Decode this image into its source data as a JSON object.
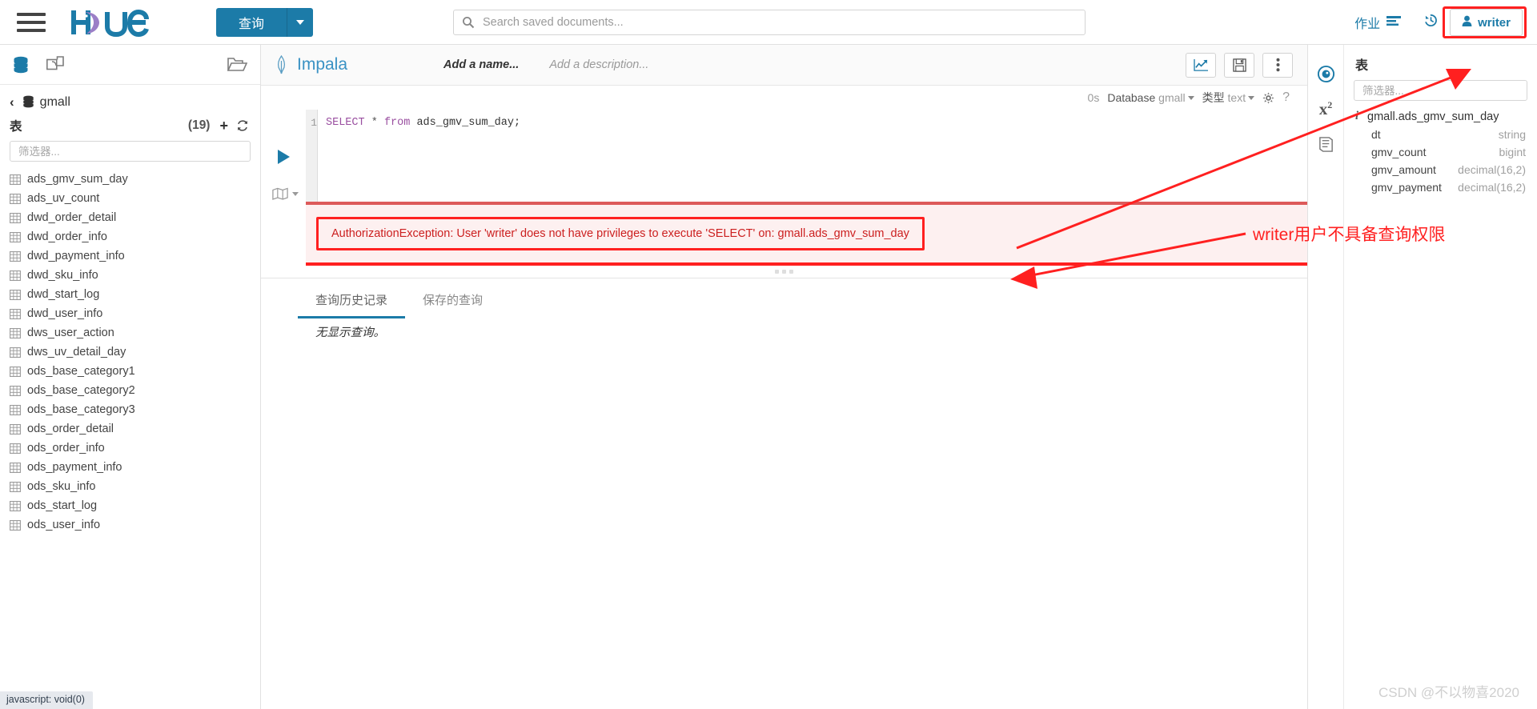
{
  "topbar": {
    "hamburger_icon": "hamburger-icon",
    "logo_text": "hue",
    "query_button_label": "查询",
    "search_placeholder": "Search saved documents...",
    "search_value": "",
    "jobs_label": "作业",
    "history_icon": "history-clock-icon",
    "user_label": "writer",
    "accent_color": "#1c7ba8",
    "highlight_color": "#ff2020"
  },
  "left_panel": {
    "back_label": "‹",
    "database_name": "gmall",
    "tables_label": "表",
    "tables_count": "(19)",
    "filter_placeholder": "筛选器...",
    "filter_value": "",
    "tables": [
      "ads_gmv_sum_day",
      "ads_uv_count",
      "dwd_order_detail",
      "dwd_order_info",
      "dwd_payment_info",
      "dwd_sku_info",
      "dwd_start_log",
      "dwd_user_info",
      "dws_user_action",
      "dws_uv_detail_day",
      "ods_base_category1",
      "ods_base_category2",
      "ods_base_category3",
      "ods_order_detail",
      "ods_order_info",
      "ods_payment_info",
      "ods_sku_info",
      "ods_start_log",
      "ods_user_info"
    ]
  },
  "editor": {
    "engine_name": "Impala",
    "name_placeholder": "Add a name...",
    "description_placeholder": "Add a description...",
    "chart_button_icon": "chart-line-icon",
    "save_button_icon": "floppy-save-icon",
    "more_button_icon": "vertical-dots-icon",
    "elapsed": "0s",
    "database_label": "Database",
    "database_value": "gmall",
    "type_label": "类型",
    "type_value": "text",
    "settings_icon": "gear-icon",
    "help_icon": "question-mark-icon",
    "line_number": "1",
    "sql": {
      "keyword_select": "SELECT",
      "star": "*",
      "keyword_from": "from",
      "table": "ads_gmv_sum_day;"
    },
    "run_icon": "play-triangle-icon",
    "map_icon": "map-fold-icon"
  },
  "error": {
    "message": "AuthorizationException: User 'writer' does not have privileges to execute 'SELECT' on: gmall.ads_gmv_sum_day",
    "border_color": "#ff2020",
    "text_color": "#cc2020",
    "background_color": "#fdf0f0"
  },
  "history": {
    "tabs": [
      {
        "label": "查询历史记录",
        "active": true
      },
      {
        "label": "保存的查询",
        "active": false
      }
    ],
    "empty_text": "无显示查询。"
  },
  "right_panel": {
    "rail_icons": [
      "compass-assist-icon",
      "x-squared-function-icon",
      "book-docs-icon"
    ],
    "title": "表",
    "filter_placeholder": "筛选器...",
    "filter_value": "",
    "table_name": "gmall.ads_gmv_sum_day",
    "columns": [
      {
        "name": "dt",
        "type": "string"
      },
      {
        "name": "gmv_count",
        "type": "bigint"
      },
      {
        "name": "gmv_amount",
        "type": "decimal(16,2)"
      },
      {
        "name": "gmv_payment",
        "type": "decimal(16,2)"
      }
    ]
  },
  "annotation": {
    "text": "writer用户不具备查询权限",
    "color": "#ff2020"
  },
  "footer": {
    "watermark": "CSDN @不以物喜2020",
    "status_text": "javascript: void(0)"
  }
}
